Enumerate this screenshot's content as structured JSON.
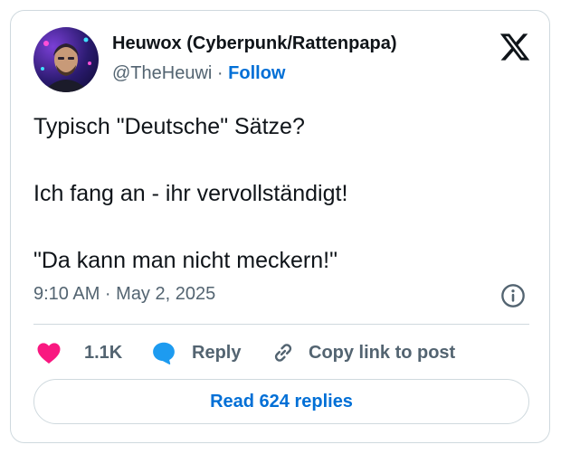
{
  "author": {
    "display_name": "Heuwox (Cyberpunk/Rattenpapa)",
    "handle": "@TheHeuwi",
    "separator": "·",
    "follow_label": "Follow"
  },
  "tweet": {
    "paragraphs": [
      "Typisch \"Deutsche\" Sätze?",
      "Ich fang an - ihr vervollständigt!",
      "\"Da kann man nicht meckern!\""
    ],
    "timestamp": "9:10 AM · May 2, 2025"
  },
  "actions": {
    "like_count": "1.1K",
    "reply_label": "Reply",
    "copy_label": "Copy link to post"
  },
  "read_replies_label": "Read 624 replies",
  "colors": {
    "accent": "#006fd6",
    "like": "#f91880",
    "reply": "#1d9bf0",
    "muted": "#536471"
  },
  "icons": [
    "x-logo-icon",
    "info-icon",
    "heart-icon",
    "reply-bubble-icon",
    "link-icon"
  ]
}
